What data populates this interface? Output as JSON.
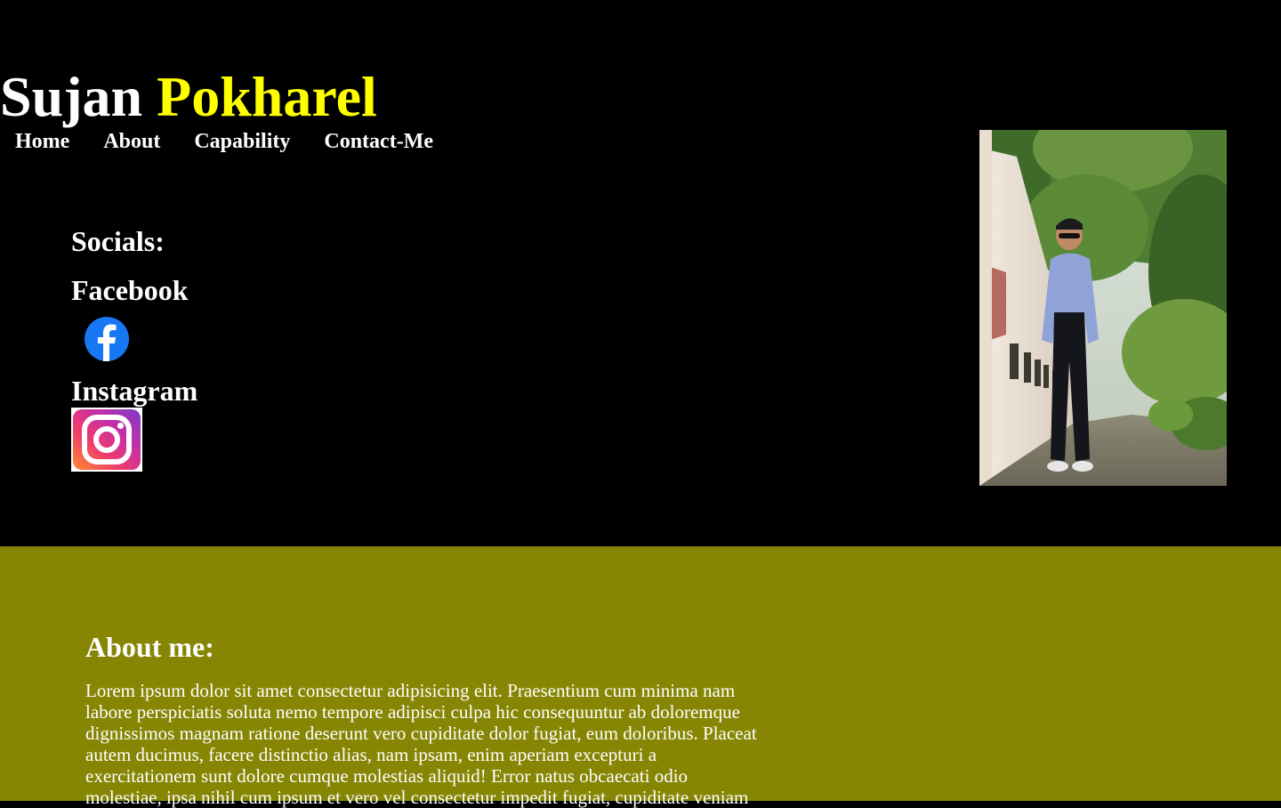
{
  "header": {
    "first_name": "Sujan",
    "last_name": "Pokharel",
    "accent_color": "#ffff00"
  },
  "nav": {
    "items": [
      "Home",
      "About",
      "Capability",
      "Contact-Me"
    ]
  },
  "socials": {
    "title": "Socials:",
    "facebook_label": "Facebook",
    "facebook_icon": "facebook-icon",
    "instagram_label": "Instagram",
    "instagram_icon": "instagram-icon"
  },
  "profile_photo": {
    "subject": "profile-photo"
  },
  "about": {
    "title": "About me:",
    "body": "Lorem ipsum dolor sit amet consectetur adipisicing elit. Praesentium cum minima nam labore perspiciatis soluta nemo tempore adipisci culpa hic consequuntur ab doloremque dignissimos magnam ratione deserunt vero cupiditate dolor fugiat, eum doloribus. Placeat autem ducimus, facere distinctio alias, nam ipsam, enim aperiam excepturi a exercitationem sunt dolore cumque molestias aliquid! Error natus obcaecati odio molestiae, ipsa nihil cum ipsum et vero vel consectetur impedit fugiat, cupiditate veniam",
    "background_color": "#868604"
  }
}
